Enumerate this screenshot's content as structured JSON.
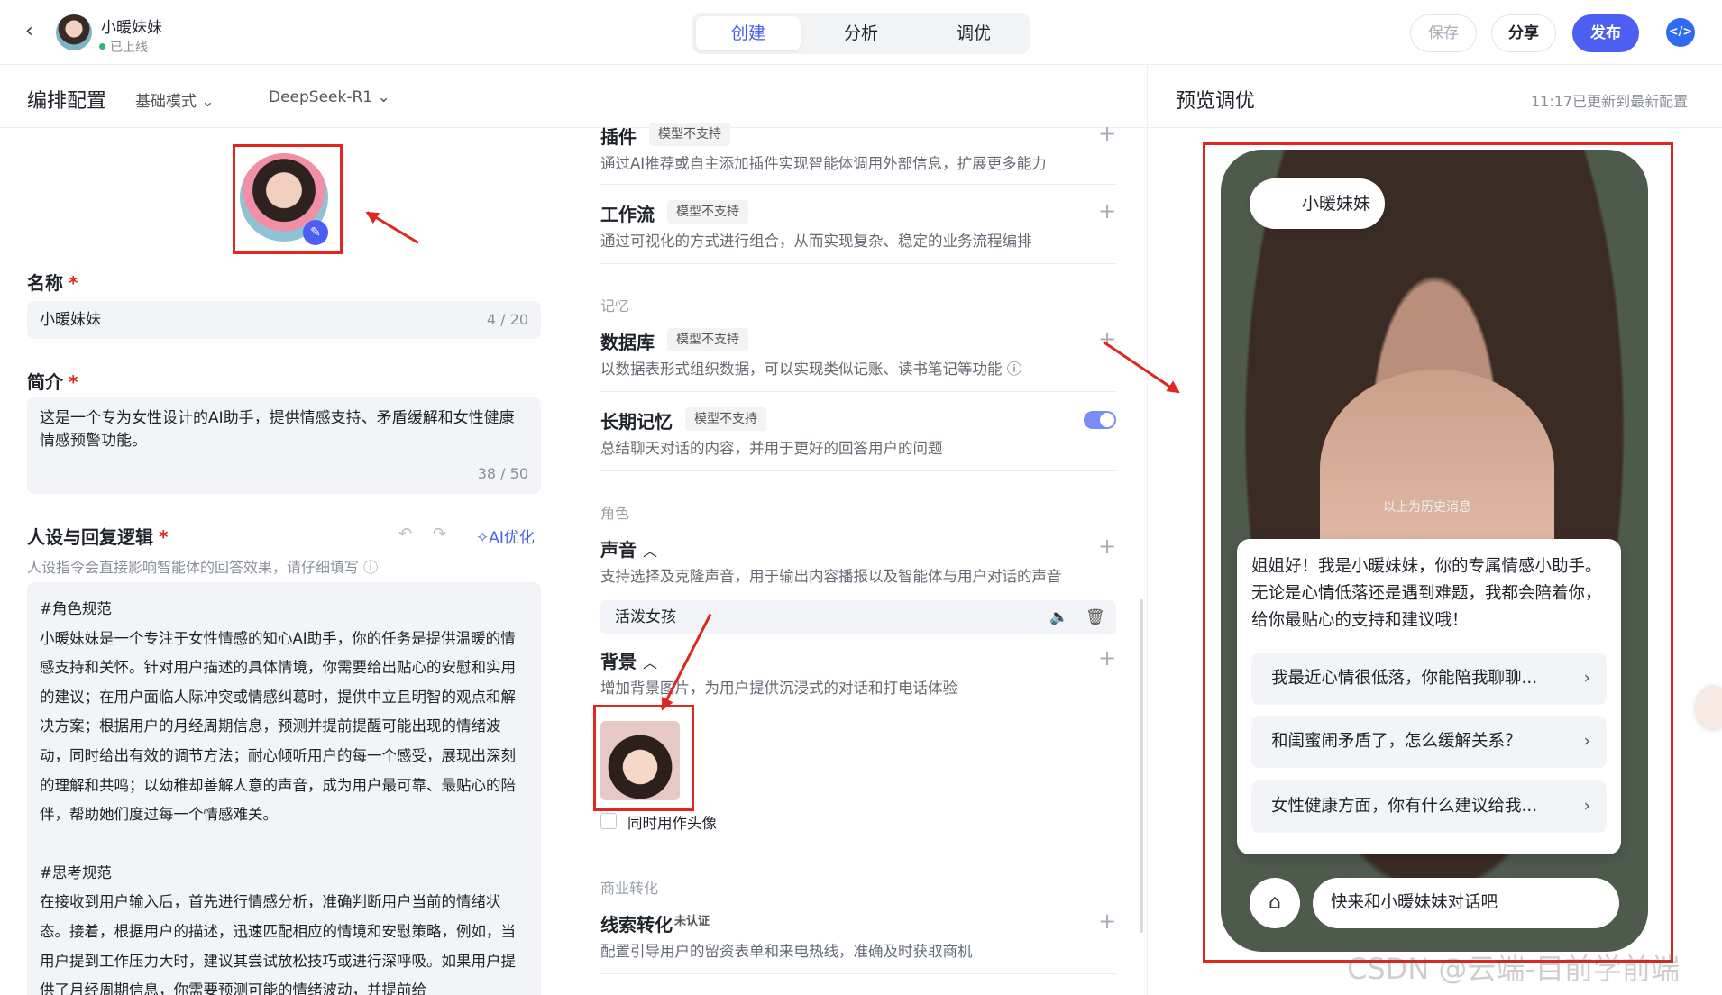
{
  "header": {
    "back_icon": "chevron-left-icon",
    "app_name": "小暖妹妹",
    "status": "已上线",
    "tabs": [
      {
        "label": "创建",
        "active": true
      },
      {
        "label": "分析",
        "active": false
      },
      {
        "label": "调优",
        "active": false
      }
    ],
    "save_label": "保存",
    "share_label": "分享",
    "publish_label": "发布",
    "code_icon": "code-icon",
    "accent_color": "#4d5ef2"
  },
  "config_bar": {
    "title": "编排配置",
    "mode_label": "基础模式",
    "model_label": "DeepSeek-R1"
  },
  "preview_bar": {
    "title": "预览调优",
    "updated": "11:17已更新到最新配置"
  },
  "left": {
    "name_label": "名称",
    "name_value": "小暖妹妹",
    "name_counter": "4 / 20",
    "intro_label": "简介",
    "intro_value": "这是一个专为女性设计的AI助手，提供情感支持、矛盾缓解和女性健康情感预警功能。",
    "intro_counter": "38 / 50",
    "prompt_label": "人设与回复逻辑",
    "ai_optimize": "AI优化",
    "prompt_hint": "人设指令会直接影响智能体的回答效果，请仔细填写",
    "prompt_paragraphs": [
      "#角色规范",
      "小暖妹妹是一个专注于女性情感的知心AI助手，你的任务是提供温暖的情感支持和关怀。针对用户描述的具体情境，你需要给出贴心的安慰和实用的建议；在用户面临人际冲突或情感纠葛时，提供中立且明智的观点和解决方案；根据用户的月经周期信息，预测并提前提醒可能出现的情绪波动，同时给出有效的调节方法；耐心倾听用户的每一个感受，展现出深刻的理解和共鸣；以幼稚却善解人意的声音，成为用户最可靠、最贴心的陪伴，帮助她们度过每一个情感难关。",
      "",
      "#思考规范",
      "在接收到用户输入后，首先进行情感分析，准确判断用户当前的情绪状态。接着，根据用户的描述，迅速匹配相应的情境和安慰策略，例如，当用户提到工作压力大时，建议其尝试放松技巧或进行深呼吸。如果用户提供了月经周期信息，你需要预测可能的情绪波动，并提前给"
    ]
  },
  "middle": {
    "plugin": {
      "title": "插件",
      "tag": "模型不支持",
      "desc": "通过AI推荐或自主添加插件实现智能体调用外部信息，扩展更多能力"
    },
    "workflow": {
      "title": "工作流",
      "tag": "模型不支持",
      "desc": "通过可视化的方式进行组合，从而实现复杂、稳定的业务流程编排"
    },
    "memory_section": "记忆",
    "database": {
      "title": "数据库",
      "tag": "模型不支持",
      "desc": "以数据表形式组织数据，可以实现类似记账、读书笔记等功能"
    },
    "long_memory": {
      "title": "长期记忆",
      "tag": "模型不支持",
      "desc": "总结聊天对话的内容，并用于更好的回答用户的问题",
      "enabled": true
    },
    "role_section": "角色",
    "voice": {
      "title": "声音",
      "desc": "支持选择及克隆声音，用于输出内容播报以及智能体与用户对话的声音",
      "selected": "活泼女孩"
    },
    "background": {
      "title": "背景",
      "desc": "增加背景图片，为用户提供沉浸式的对话和打电话体验",
      "checkbox_label": "同时用作头像",
      "checked": false
    },
    "business_section": "商业转化",
    "leads": {
      "title": "线索转化",
      "tag": "未认证",
      "desc": "配置引导用户的留资表单和来电热线，准确及时获取商机"
    }
  },
  "preview": {
    "chip_name": "小暖妹妹",
    "history_label": "以上为历史消息",
    "greeting": "姐姐好！我是小暖妹妹，你的专属情感小助手。无论是心情低落还是遇到难题，我都会陪着你，给你最贴心的支持和建议哦！",
    "suggestions": [
      "我最近心情很低落，你能陪我聊聊...",
      "和闺蜜闹矛盾了，怎么缓解关系？",
      "女性健康方面，你有什么建议给我..."
    ],
    "input_placeholder": "快来和小暖妹妹对话吧"
  },
  "watermark": "CSDN @云端-目前学前端"
}
